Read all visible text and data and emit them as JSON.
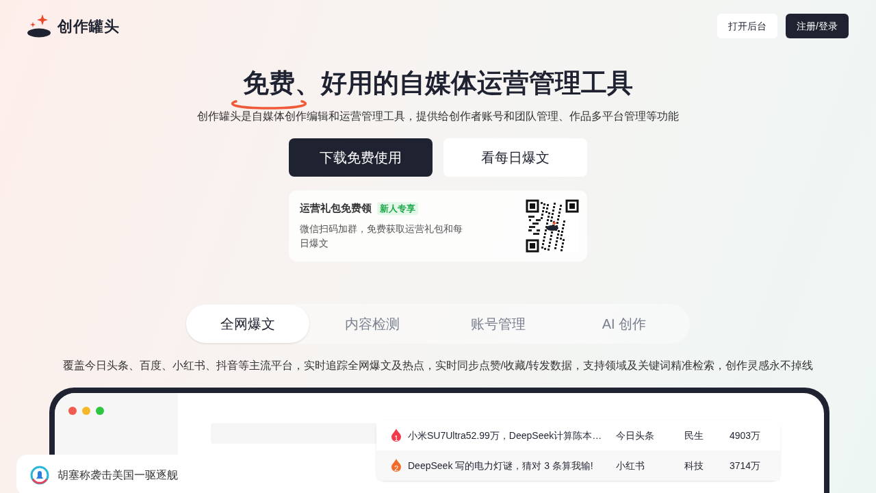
{
  "brand": {
    "name": "创作罐头"
  },
  "header_buttons": [
    {
      "label": "打开后台",
      "kind": "light"
    },
    {
      "label": "注册/登录",
      "kind": "dark"
    }
  ],
  "hero": {
    "highlight": "免费",
    "title_rest": "、好用的自媒体运营管理工具",
    "subtitle": "创作罐头是自媒体创作编辑和运营管理工具，提供给创作者账号和团队管理、作品多平台管理等功能"
  },
  "cta_buttons": [
    {
      "label": "下载免费使用",
      "kind": "dark"
    },
    {
      "label": "看每日爆文",
      "kind": "light"
    }
  ],
  "gift_card": {
    "title": "运营礼包免费领",
    "badge": "新人专享",
    "description": "微信扫码加群，免费获取运营礼包和每日爆文"
  },
  "tabs": [
    {
      "label": "全网爆文",
      "selected": true
    },
    {
      "label": "内容检测",
      "selected": false
    },
    {
      "label": "账号管理",
      "selected": false
    },
    {
      "label": "AI 创作",
      "selected": false
    }
  ],
  "tab_description": "覆盖今日头条、百度、小红书、抖音等主流平台，实时追踪全网爆文及热点，实时同步点赞/收藏/转发数据，支持领域及关键词精准检索，创作灵感永不掉线",
  "hot_list": [
    {
      "rank": "1",
      "color": "#ef3b4b",
      "title": "小米SU7Ultra52.99万，DeepSeek计算陈本…",
      "platform": "今日头条",
      "field": "民生",
      "count": "4903万"
    },
    {
      "rank": "2",
      "color": "#f26b2a",
      "title": "DeepSeek 写的电力灯谜，猜对 3 条算我输!",
      "platform": "小红书",
      "field": "科技",
      "count": "3714万"
    }
  ],
  "notification": {
    "text": "胡塞称袭击美国一驱逐舰"
  }
}
